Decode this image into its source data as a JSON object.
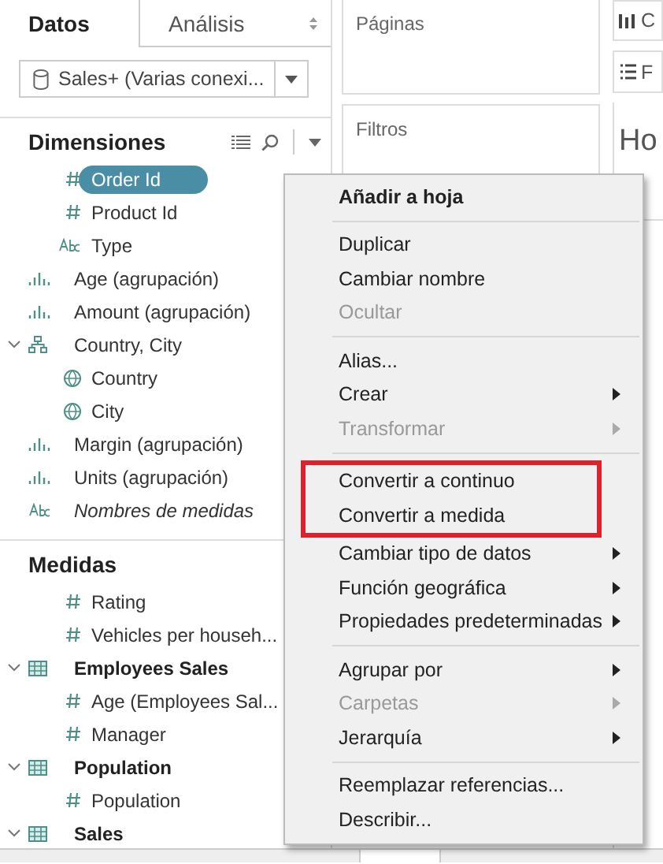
{
  "tabs": [
    {
      "label": "Datos",
      "selected": true
    },
    {
      "label": "Análisis",
      "selected": false
    }
  ],
  "datasource": {
    "value": "Sales+ (Varias conexi..."
  },
  "sections": [
    {
      "title": "Dimensiones",
      "tools": true,
      "items": [
        {
          "label": "Order Id",
          "kind": "number",
          "selected": true,
          "italic": false
        },
        {
          "label": "Product Id",
          "kind": "number",
          "selected": false,
          "italic": false
        },
        {
          "label": "Type",
          "kind": "text",
          "selected": false,
          "italic": false
        },
        {
          "label": "Age (agrupación)",
          "kind": "bins",
          "selected": false,
          "italic": false
        },
        {
          "label": "Amount (agrupación)",
          "kind": "bins",
          "selected": false,
          "italic": false
        },
        {
          "label": "Country, City",
          "kind": "hierarchy",
          "selected": false,
          "italic": false,
          "expanded": true,
          "children": [
            {
              "label": "Country",
              "kind": "geo",
              "selected": false,
              "italic": false
            },
            {
              "label": "City",
              "kind": "geo",
              "selected": false,
              "italic": false
            }
          ]
        },
        {
          "label": "Margin (agrupación)",
          "kind": "bins",
          "selected": false,
          "italic": false
        },
        {
          "label": "Units (agrupación)",
          "kind": "bins",
          "selected": false,
          "italic": false
        },
        {
          "label": "Nombres de medidas",
          "kind": "measure-names",
          "selected": false,
          "italic": true
        }
      ]
    },
    {
      "title": "Medidas",
      "tools": false,
      "items": [
        {
          "label": "Rating",
          "kind": "number",
          "selected": false,
          "italic": false
        },
        {
          "label": "Vehicles per househ...",
          "kind": "number",
          "selected": false,
          "italic": false
        },
        {
          "label": "Employees Sales",
          "kind": "table",
          "selected": false,
          "italic": false,
          "expanded": true,
          "children": [
            {
              "label": "Age (Employees Sal...",
              "kind": "number",
              "selected": false,
              "italic": false
            },
            {
              "label": "Manager",
              "kind": "number",
              "selected": false,
              "italic": false
            }
          ]
        },
        {
          "label": "Population",
          "kind": "table",
          "selected": false,
          "italic": false,
          "expanded": true,
          "children": [
            {
              "label": "Population",
              "kind": "number",
              "selected": false,
              "italic": false
            }
          ]
        },
        {
          "label": "Sales",
          "kind": "table",
          "selected": false,
          "italic": false,
          "expanded": true
        }
      ]
    }
  ],
  "shelves": [
    {
      "title": "Páginas"
    },
    {
      "title": "Filtros"
    }
  ],
  "cards": [
    {
      "kind": "columns",
      "label": "C"
    },
    {
      "kind": "rows",
      "label": "F"
    }
  ],
  "sheet": {
    "title": "Ho"
  },
  "context_menu": {
    "groups": [
      [
        {
          "label": "Añadir a hoja",
          "bold": true,
          "disabled": false,
          "submenu": false,
          "highlighted": false
        }
      ],
      [
        {
          "label": "Duplicar",
          "bold": false,
          "disabled": false,
          "submenu": false,
          "highlighted": false
        },
        {
          "label": "Cambiar nombre",
          "bold": false,
          "disabled": false,
          "submenu": false,
          "highlighted": false
        },
        {
          "label": "Ocultar",
          "bold": false,
          "disabled": true,
          "submenu": false,
          "highlighted": false
        }
      ],
      [
        {
          "label": "Alias...",
          "bold": false,
          "disabled": false,
          "submenu": false,
          "highlighted": false
        },
        {
          "label": "Crear",
          "bold": false,
          "disabled": false,
          "submenu": true,
          "highlighted": false
        },
        {
          "label": "Transformar",
          "bold": false,
          "disabled": true,
          "submenu": true,
          "highlighted": false
        }
      ],
      [
        {
          "label": "Convertir a continuo",
          "bold": false,
          "disabled": false,
          "submenu": false,
          "highlighted": true
        },
        {
          "label": "Convertir a medida",
          "bold": false,
          "disabled": false,
          "submenu": false,
          "highlighted": true
        },
        {
          "label": "Cambiar tipo de datos",
          "bold": false,
          "disabled": false,
          "submenu": true,
          "highlighted": false
        },
        {
          "label": "Función geográfica",
          "bold": false,
          "disabled": false,
          "submenu": true,
          "highlighted": false
        },
        {
          "label": "Propiedades predeterminadas",
          "bold": false,
          "disabled": false,
          "submenu": true,
          "highlighted": false
        }
      ],
      [
        {
          "label": "Agrupar por",
          "bold": false,
          "disabled": false,
          "submenu": true,
          "highlighted": false
        },
        {
          "label": "Carpetas",
          "bold": false,
          "disabled": true,
          "submenu": true,
          "highlighted": false
        },
        {
          "label": "Jerarquía",
          "bold": false,
          "disabled": false,
          "submenu": true,
          "highlighted": false
        }
      ],
      [
        {
          "label": "Reemplazar referencias...",
          "bold": false,
          "disabled": false,
          "submenu": false,
          "highlighted": false
        },
        {
          "label": "Describir...",
          "bold": false,
          "disabled": false,
          "submenu": false,
          "highlighted": false
        }
      ]
    ]
  }
}
